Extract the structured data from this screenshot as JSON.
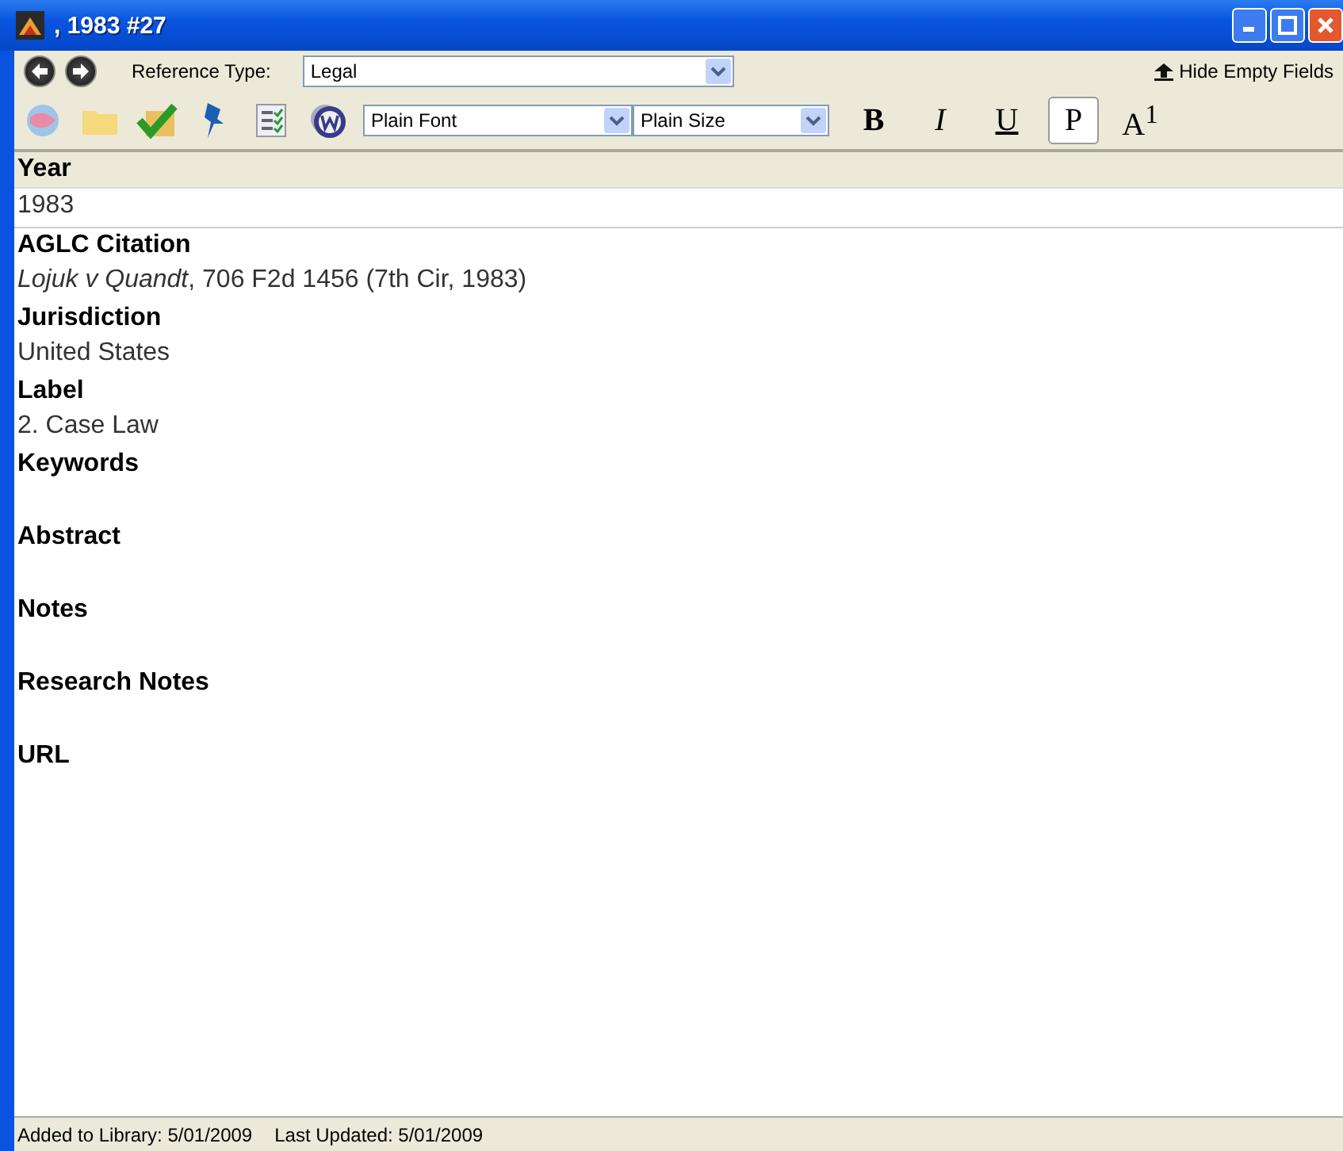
{
  "window": {
    "title": ", 1983 #27"
  },
  "reference_type": {
    "label": "Reference Type:",
    "value": "Legal"
  },
  "hide_empty_fields": "Hide Empty Fields",
  "toolbar": {
    "font": "Plain Font",
    "size": "Plain Size",
    "format_buttons": [
      {
        "label": "B",
        "selected": false
      },
      {
        "label": "I",
        "selected": false
      },
      {
        "label": "U",
        "selected": false
      },
      {
        "label": "P",
        "selected": true
      },
      {
        "label": "A$^{1}$",
        "selected": false
      }
    ]
  },
  "fields": [
    {
      "label": "Year",
      "value": "1983",
      "active": true
    },
    {
      "label": "AGLC Citation",
      "value": "*Lojuk v Quandt*, 706 F2d 1456 (7th Cir, 1983)",
      "active": false
    },
    {
      "label": "Jurisdiction",
      "value": "United States",
      "active": false
    },
    {
      "label": "Label",
      "value": "2. Case Law",
      "active": false
    },
    {
      "label": "Keywords",
      "active": false
    },
    {
      "label": "Abstract",
      "active": false
    },
    {
      "label": "Notes",
      "active": false
    },
    {
      "label": "Research Notes",
      "active": false
    },
    {
      "label": "URL",
      "active": false
    }
  ],
  "status_bar": {
    "added": "Added to Library: 5/01/2009",
    "updated": "Last Updated: 5/01/2009"
  }
}
